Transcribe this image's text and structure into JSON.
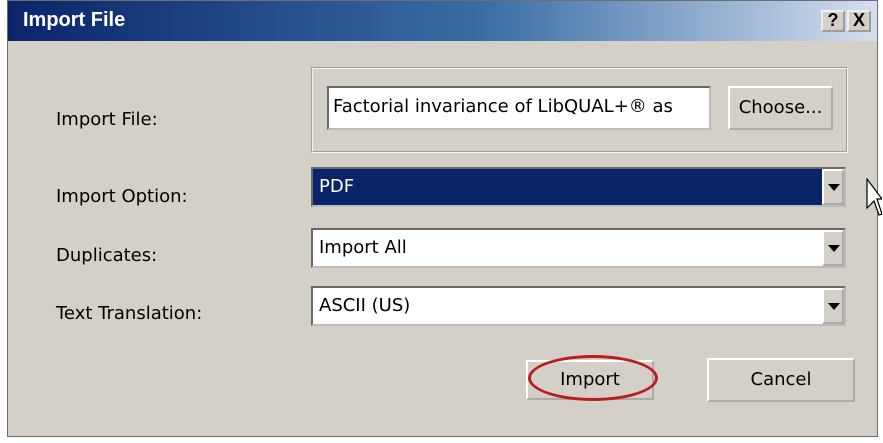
{
  "window": {
    "title": "Import File",
    "help_glyph": "?",
    "close_glyph": "X"
  },
  "import_file": {
    "label": "Import File:",
    "value": "Factorial invariance of LibQUAL+® as",
    "choose_label": "Choose..."
  },
  "import_option": {
    "label": "Import Option:",
    "value": "PDF"
  },
  "duplicates": {
    "label": "Duplicates:",
    "value": "Import All"
  },
  "text_translation": {
    "label": "Text Translation:",
    "value": "ASCII (US)"
  },
  "buttons": {
    "import_label": "Import",
    "cancel_label": "Cancel"
  },
  "colors": {
    "selection": "#0a246a",
    "annotation": "#b81c1c",
    "dialog_bg": "#d4d0c8"
  },
  "icons": [
    "help-icon",
    "close-icon",
    "dropdown-arrow-icon",
    "mouse-cursor-icon"
  ]
}
